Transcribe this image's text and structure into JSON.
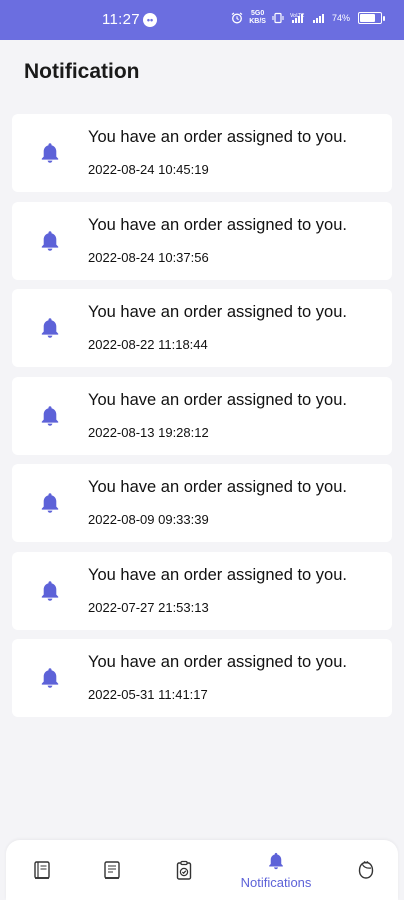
{
  "status_bar": {
    "time": "11:27",
    "app_badge": "••",
    "network_1": "5G0",
    "network_2": "KB/S",
    "battery": "74%",
    "battery_level": 0.74,
    "color": "#6b6ee0"
  },
  "page": {
    "title": "Notification"
  },
  "notifications": [
    {
      "title": "You have an order assigned to you.",
      "time": "2022-08-24 10:45:19",
      "icon": "bell-icon"
    },
    {
      "title": "You have an order assigned to you.",
      "time": "2022-08-24 10:37:56",
      "icon": "bell-icon"
    },
    {
      "title": "You have an order assigned to you.",
      "time": "2022-08-22 11:18:44",
      "icon": "bell-icon"
    },
    {
      "title": "You have an order assigned to you.",
      "time": "2022-08-13 19:28:12",
      "icon": "bell-icon"
    },
    {
      "title": "You have an order assigned to you.",
      "time": "2022-08-09 09:33:39",
      "icon": "bell-icon"
    },
    {
      "title": "You have an order assigned to you.",
      "time": "2022-07-27 21:53:13",
      "icon": "bell-icon"
    },
    {
      "title": "You have an order assigned to you.",
      "time": "2022-05-31 11:41:17",
      "icon": "bell-icon"
    }
  ],
  "bottom_nav": {
    "items": [
      {
        "icon": "book-icon",
        "label": ""
      },
      {
        "icon": "document-icon",
        "label": ""
      },
      {
        "icon": "clipboard-check-icon",
        "label": ""
      },
      {
        "icon": "bell-icon",
        "label": "Notifications",
        "active": true
      },
      {
        "icon": "profile-icon",
        "label": ""
      }
    ],
    "accent_color": "#5d62d8"
  }
}
